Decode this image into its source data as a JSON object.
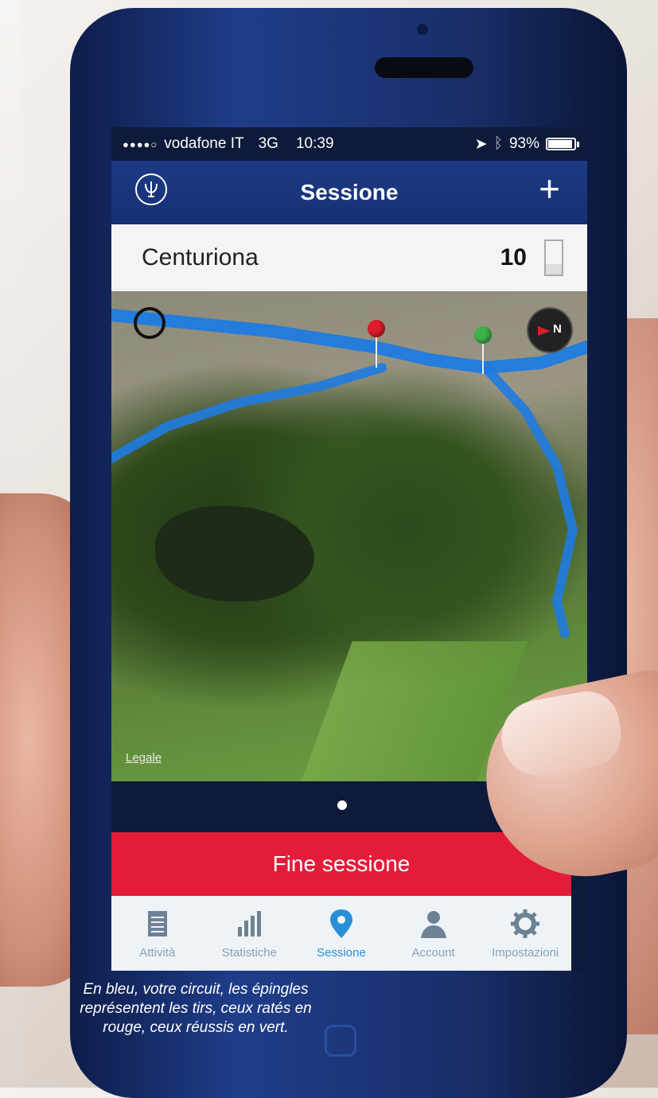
{
  "status_bar": {
    "signal": "●●●●○",
    "carrier": "vodafone IT",
    "network": "3G",
    "time": "10:39",
    "battery": "93%",
    "battery_level": 0.93
  },
  "nav": {
    "title": "Sessione",
    "add_label": "+"
  },
  "field": {
    "name": "Centuriona",
    "count": "10"
  },
  "map": {
    "legal_label": "Legale",
    "compass_letter": "N",
    "route_color": "#1f7be0",
    "pins": [
      {
        "result": "missed",
        "color": "#e01b2a"
      },
      {
        "result": "hit",
        "color": "#3db34a"
      }
    ]
  },
  "end_button": {
    "label": "Fine sessione",
    "color": "#e51b3a"
  },
  "tabs": [
    {
      "label": "Attività",
      "icon": "list-icon",
      "active": false
    },
    {
      "label": "Statistiche",
      "icon": "bar-chart-icon",
      "active": false
    },
    {
      "label": "Sessione",
      "icon": "location-pin-icon",
      "active": true
    },
    {
      "label": "Account",
      "icon": "user-icon",
      "active": false
    },
    {
      "label": "Impostazioni",
      "icon": "gear-icon",
      "active": false
    }
  ],
  "caption": "En bleu, votre circuit, les épingles représentent les tirs, ceux ratés en rouge, ceux réussis en vert.",
  "colors": {
    "nav_blue": "#1c3a86",
    "tab_active": "#2a8fd6",
    "tab_inactive": "#8aa0b4"
  }
}
